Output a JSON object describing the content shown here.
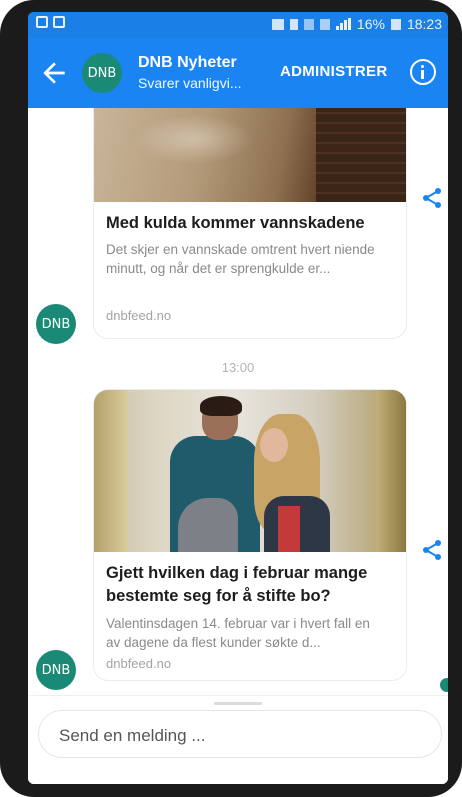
{
  "status_bar": {
    "battery_text": "16%",
    "time": "18:23"
  },
  "header": {
    "avatar_text": "DNB",
    "title": "DNB Nyheter",
    "subtitle": "Svarer vanligvi...",
    "manage_label": "ADMINISTRER"
  },
  "messages": [
    {
      "title": "Med kulda kommer vannskadene",
      "description": "Det skjer en vannskade omtrent hvert niende minutt, og når det er sprengkulde er...",
      "source": "dnbfeed.no",
      "avatar_text": "DNB"
    },
    {
      "title": "Gjett hvilken dag i februar mange bestemte seg for å stifte bo?",
      "description": "Valentinsdagen 14. februar var i hvert fall en av dagene da flest kunder søkte d...",
      "source": "dnbfeed.no",
      "avatar_text": "DNB"
    }
  ],
  "timestamp": "13:00",
  "composer": {
    "placeholder": "Send en melding ..."
  },
  "colors": {
    "brand_blue": "#1a85f2",
    "avatar_green": "#1a8a76",
    "share_blue": "#1a85f2"
  },
  "icons": {
    "back": "arrow-left-icon",
    "info": "info-icon",
    "share": "share-icon"
  }
}
